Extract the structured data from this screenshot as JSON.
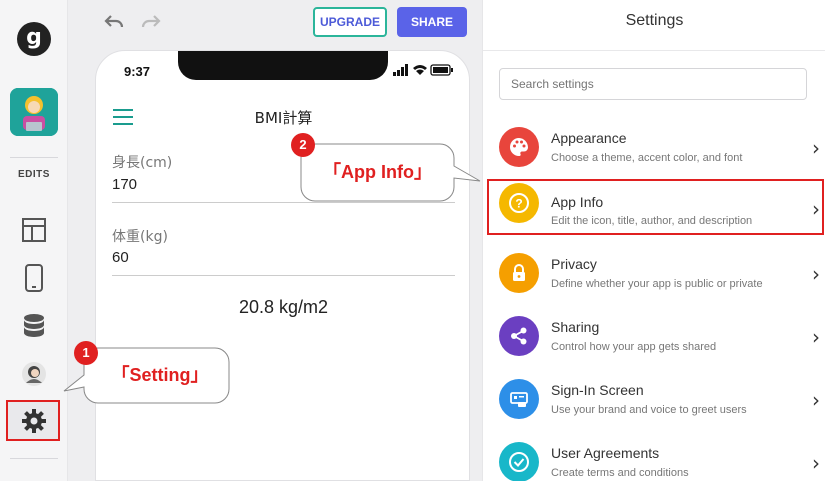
{
  "rail": {
    "logo_letter": "g",
    "edits_label": "EDITS"
  },
  "toolbar": {
    "upgrade_label": "UPGRADE",
    "share_label": "SHARE"
  },
  "phone": {
    "time": "9:37",
    "app_title": "BMI計算",
    "height_label": "身長(cm)",
    "height_value": "170",
    "weight_label": "体重(kg)",
    "weight_value": "60",
    "result": "20.8 kg/m2"
  },
  "settings": {
    "title": "Settings",
    "search_placeholder": "Search settings",
    "items": [
      {
        "title": "Appearance",
        "desc": "Choose a theme, accent color, and font",
        "color": "#e8453c"
      },
      {
        "title": "App Info",
        "desc": "Edit the icon, title, author, and description",
        "color": "#f5b800"
      },
      {
        "title": "Privacy",
        "desc": "Define whether your app is public or private",
        "color": "#f59f00"
      },
      {
        "title": "Sharing",
        "desc": "Control how your app gets shared",
        "color": "#6b3fc1"
      },
      {
        "title": "Sign-In Screen",
        "desc": "Use your brand and voice to greet users",
        "color": "#2d8fe8"
      },
      {
        "title": "User Agreements",
        "desc": "Create terms and conditions",
        "color": "#18b7c9"
      }
    ]
  },
  "callouts": {
    "app_info": {
      "number": "2",
      "text": "「App Info」"
    },
    "setting": {
      "number": "1",
      "text": "「Setting」"
    }
  }
}
